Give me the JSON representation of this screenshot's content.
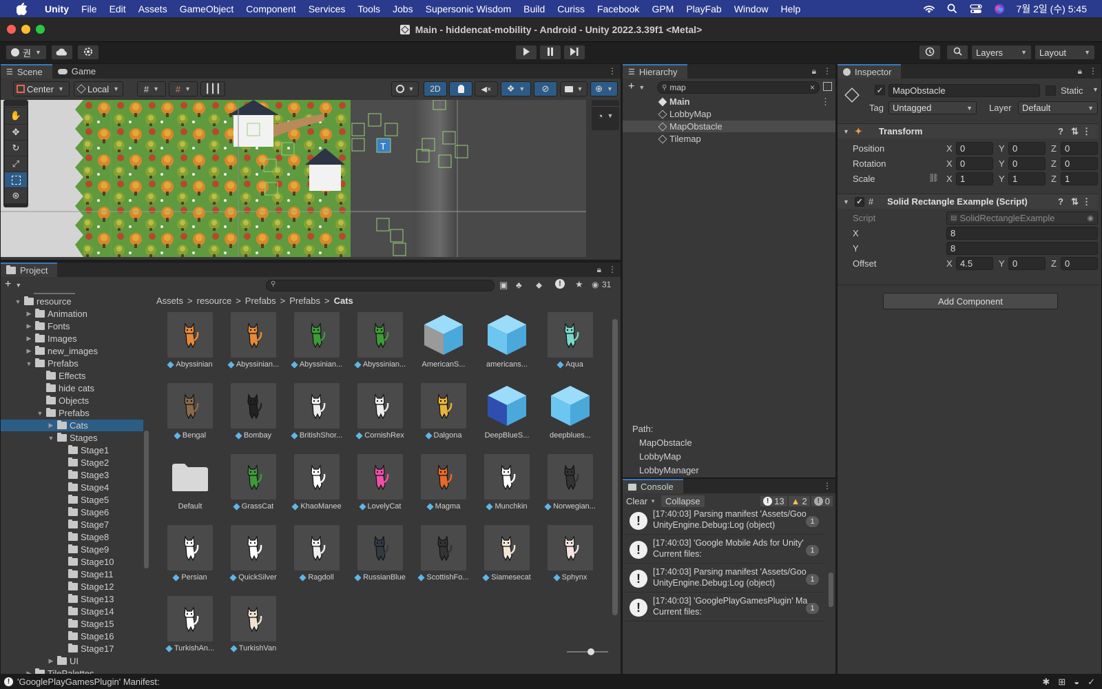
{
  "menubar": {
    "app_name": "Unity",
    "items": [
      "File",
      "Edit",
      "Assets",
      "GameObject",
      "Component",
      "Services",
      "Tools",
      "Jobs",
      "Supersonic Wisdom",
      "Build",
      "Curiss",
      "Facebook",
      "GPM",
      "PlayFab",
      "Window",
      "Help"
    ],
    "clock": "7월 2일 (수) 5:45"
  },
  "window": {
    "title": "Main - hiddencat-mobility - Android - Unity 2022.3.39f1 <Metal>"
  },
  "toolbar": {
    "account_label": "권",
    "layers_label": "Layers",
    "layout_label": "Layout"
  },
  "scene": {
    "tab_scene": "Scene",
    "tab_game": "Game",
    "pivot_label": "Center",
    "space_label": "Local",
    "mode_2d_label": "2D"
  },
  "hierarchy": {
    "tab_label": "Hierarchy",
    "search_value": "map",
    "items": [
      "Main",
      "LobbyMap",
      "MapObstacle",
      "Tilemap"
    ],
    "path_label": "Path:",
    "path_items": [
      "MapObstacle",
      "LobbyMap",
      "LobbyManager"
    ]
  },
  "inspector": {
    "tab_label": "Inspector",
    "object_name": "MapObstacle",
    "static_label": "Static",
    "tag_label": "Tag",
    "tag_value": "Untagged",
    "layer_label": "Layer",
    "layer_value": "Default",
    "transform": {
      "title": "Transform",
      "position_label": "Position",
      "rotation_label": "Rotation",
      "scale_label": "Scale",
      "position": [
        "0",
        "0",
        "0"
      ],
      "rotation": [
        "0",
        "0",
        "0"
      ],
      "scale": [
        "1",
        "1",
        "1"
      ]
    },
    "script_component": {
      "title": "Solid Rectangle Example (Script)",
      "script_label": "Script",
      "script_value": "SolidRectangleExample",
      "x_label": "X",
      "x_value": "8",
      "y_label": "Y",
      "y_value": "8",
      "offset_label": "Offset",
      "offset": [
        "4.5",
        "0",
        "0"
      ]
    },
    "axis_labels": [
      "X",
      "Y",
      "Z"
    ],
    "add_component_label": "Add Component"
  },
  "project": {
    "tab_label": "Project",
    "visible_count": "31",
    "breadcrumb": [
      "Assets",
      "resource",
      "Prefabs",
      "Prefabs",
      "Cats"
    ],
    "tree": [
      {
        "label": "resource"
      },
      {
        "label": "Animation"
      },
      {
        "label": "Fonts"
      },
      {
        "label": "Images"
      },
      {
        "label": "new_images"
      },
      {
        "label": "Prefabs"
      },
      {
        "label": "Effects"
      },
      {
        "label": "hide cats"
      },
      {
        "label": "Objects"
      },
      {
        "label": "Prefabs"
      },
      {
        "label": "Cats"
      },
      {
        "label": "Stages"
      },
      {
        "label": "Stage1"
      },
      {
        "label": "Stage2"
      },
      {
        "label": "Stage3"
      },
      {
        "label": "Stage4"
      },
      {
        "label": "Stage5"
      },
      {
        "label": "Stage6"
      },
      {
        "label": "Stage7"
      },
      {
        "label": "Stage8"
      },
      {
        "label": "Stage9"
      },
      {
        "label": "Stage10"
      },
      {
        "label": "Stage11"
      },
      {
        "label": "Stage12"
      },
      {
        "label": "Stage13"
      },
      {
        "label": "Stage14"
      },
      {
        "label": "Stage15"
      },
      {
        "label": "Stage16"
      },
      {
        "label": "Stage17"
      },
      {
        "label": "UI"
      },
      {
        "label": "TilePalettes"
      }
    ],
    "assets": [
      {
        "label": "Abyssinian",
        "color": "#e58a3a"
      },
      {
        "label": "Abyssinian...",
        "color": "#e58a3a"
      },
      {
        "label": "Abyssinian...",
        "color": "#3f9a3a"
      },
      {
        "label": "Abyssinian...",
        "color": "#3f9a3a"
      },
      {
        "label": "AmericanS...",
        "color": "#9a9a9a"
      },
      {
        "label": "americans...",
        "color": "#6cc6f0"
      },
      {
        "label": "Aqua",
        "color": "#79d9c9"
      },
      {
        "label": "Bengal",
        "color": "#8a6a4a"
      },
      {
        "label": "Bombay",
        "color": "#222222"
      },
      {
        "label": "BritishShor...",
        "color": "#eeeeee"
      },
      {
        "label": "CornishRex",
        "color": "#eeeeee"
      },
      {
        "label": "Dalgona",
        "color": "#e9b23a"
      },
      {
        "label": "DeepBlueS...",
        "color": "#2f4fb0"
      },
      {
        "label": "deepblues...",
        "color": "#6cc6f0"
      },
      {
        "label": "Default",
        "color": "#d8d8d8"
      },
      {
        "label": "GrassCat",
        "color": "#3f9a3a"
      },
      {
        "label": "KhaoManee",
        "color": "#ffffff"
      },
      {
        "label": "LovelyCat",
        "color": "#f04fa8"
      },
      {
        "label": "Magma",
        "color": "#e86a2a"
      },
      {
        "label": "Munchkin",
        "color": "#ffffff"
      },
      {
        "label": "Norwegian...",
        "color": "#333333"
      },
      {
        "label": "Persian",
        "color": "#ffffff"
      },
      {
        "label": "QuickSilver",
        "color": "#ffffff"
      },
      {
        "label": "Ragdoll",
        "color": "#eeeeee"
      },
      {
        "label": "RussianBlue",
        "color": "#333a44"
      },
      {
        "label": "ScottishFo...",
        "color": "#333333"
      },
      {
        "label": "Siamesecat",
        "color": "#f2e6d6"
      },
      {
        "label": "Sphynx",
        "color": "#f6e4e0"
      },
      {
        "label": "TurkishAn...",
        "color": "#ffffff"
      },
      {
        "label": "TurkishVan",
        "color": "#f0e2d0"
      }
    ]
  },
  "console": {
    "tab_label": "Console",
    "clear_label": "Clear",
    "collapse_label": "Collapse",
    "log_count": "13",
    "warn_count": "2",
    "error_count": "0",
    "entries": [
      {
        "line1": "[17:40:03] Parsing manifest 'Assets/Goo",
        "line2": "UnityEngine.Debug:Log (object)",
        "count": "1"
      },
      {
        "line1": "[17:40:03] 'Google Mobile Ads for Unity'",
        "line2": "Current files:",
        "count": "1"
      },
      {
        "line1": "[17:40:03] Parsing manifest 'Assets/Goo",
        "line2": "UnityEngine.Debug:Log (object)",
        "count": "1"
      },
      {
        "line1": "[17:40:03] 'GooglePlayGamesPlugin' Ma",
        "line2": "Current files:",
        "count": "1"
      }
    ]
  },
  "statusbar": {
    "message": "'GooglePlayGamesPlugin' Manifest:"
  }
}
